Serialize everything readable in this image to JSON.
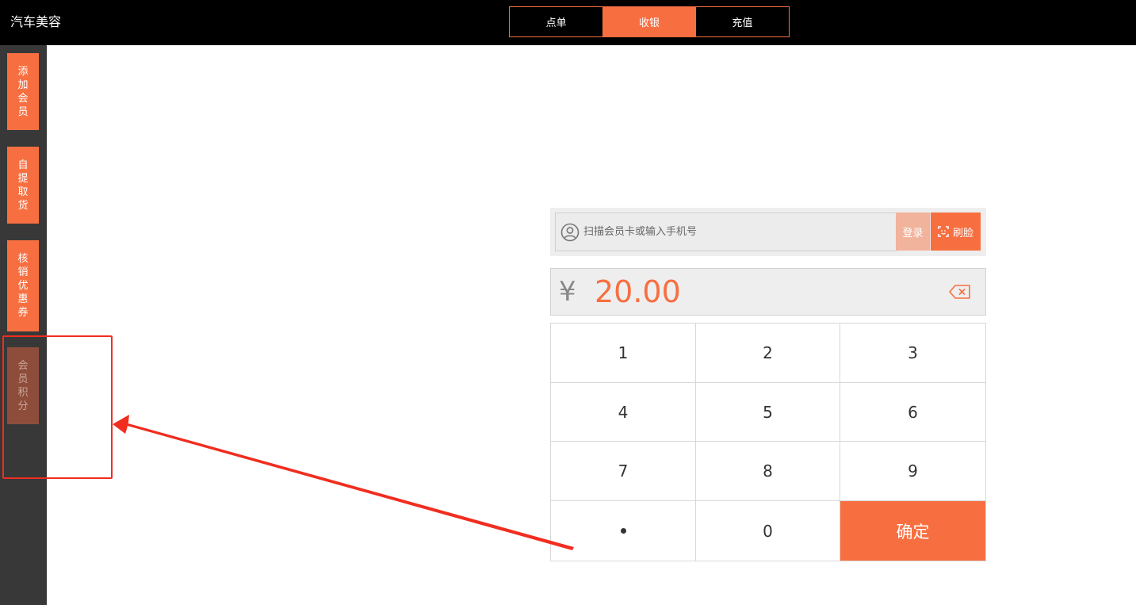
{
  "app": {
    "title": "汽车美容"
  },
  "tabs": [
    {
      "label": "点单",
      "active": false
    },
    {
      "label": "收银",
      "active": true
    },
    {
      "label": "充值",
      "active": false
    }
  ],
  "sidebar": {
    "items": [
      {
        "label_chars": [
          "添",
          "加",
          "会",
          "员"
        ]
      },
      {
        "label_chars": [
          "自",
          "提",
          "取",
          "货"
        ]
      },
      {
        "label_chars": [
          "核",
          "销",
          "优",
          "惠",
          "券"
        ]
      },
      {
        "label_chars": [
          "会",
          "员",
          "积",
          "分"
        ],
        "dimmed": true
      }
    ]
  },
  "member": {
    "placeholder": "扫描会员卡或输入手机号",
    "login_label": "登录",
    "face_label": "刷脸"
  },
  "amount": {
    "currency": "¥",
    "value": "20.00"
  },
  "keypad": {
    "keys": [
      "1",
      "2",
      "3",
      "4",
      "5",
      "6",
      "7",
      "8",
      "9",
      "dot",
      "0"
    ],
    "confirm_label": "确定"
  },
  "colors": {
    "accent": "#f76f41",
    "annotation": "#f12d1f",
    "topbar": "#000000",
    "sidebar": "#383838"
  }
}
